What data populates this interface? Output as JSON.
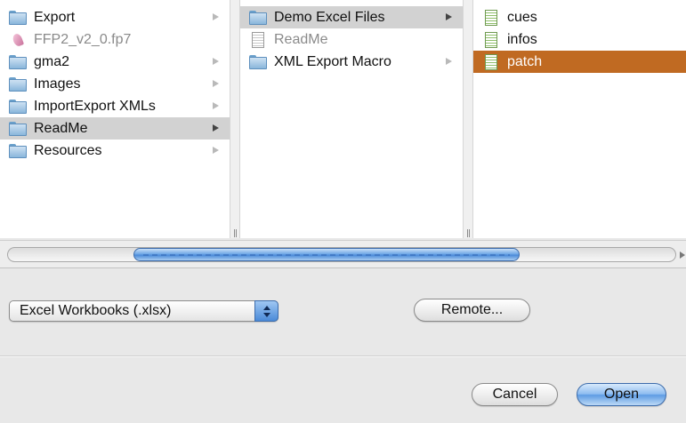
{
  "column1": {
    "items": [
      {
        "label": "Export",
        "icon": "folder-icon",
        "has_arrow": true
      },
      {
        "label": "FFP2_v2_0.fp7",
        "icon": "filemaker-file-icon",
        "has_arrow": false,
        "dimmed": true
      },
      {
        "label": "gma2",
        "icon": "folder-icon",
        "has_arrow": true
      },
      {
        "label": "Images",
        "icon": "folder-icon",
        "has_arrow": true
      },
      {
        "label": "ImportExport XMLs",
        "icon": "folder-icon",
        "has_arrow": true
      },
      {
        "label": "ReadMe",
        "icon": "folder-icon",
        "has_arrow": true,
        "selected": true
      },
      {
        "label": "Resources",
        "icon": "folder-icon",
        "has_arrow": true
      }
    ]
  },
  "column2": {
    "items": [
      {
        "label": "Demo Excel Files",
        "icon": "folder-icon",
        "has_arrow": true,
        "selected": true
      },
      {
        "label": "ReadMe",
        "icon": "document-icon",
        "has_arrow": false,
        "dimmed": true
      },
      {
        "label": "XML Export Macro",
        "icon": "folder-icon",
        "has_arrow": true
      }
    ]
  },
  "column3": {
    "items": [
      {
        "label": "cues",
        "icon": "spreadsheet-icon"
      },
      {
        "label": "infos",
        "icon": "spreadsheet-icon"
      },
      {
        "label": "patch",
        "icon": "spreadsheet-icon",
        "selected": true
      }
    ]
  },
  "format_popup": {
    "selected": "Excel Workbooks (.xlsx)"
  },
  "buttons": {
    "remote": "Remote...",
    "cancel": "Cancel",
    "open": "Open"
  },
  "colors": {
    "selection_active": "#c06a22",
    "selection_inactive": "#d2d2d2",
    "accent_blue": "#4a8ad8"
  }
}
